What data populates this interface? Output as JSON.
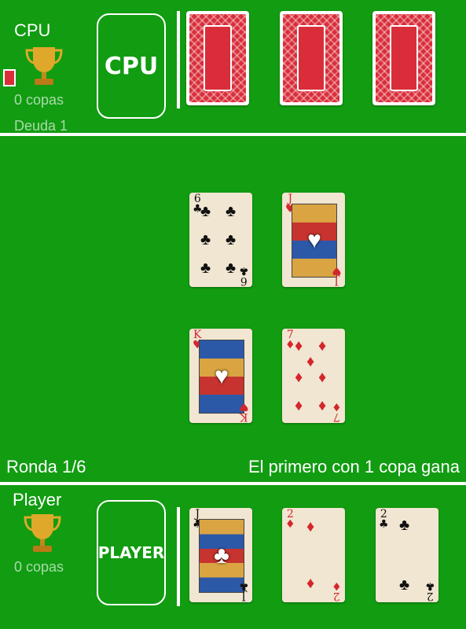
{
  "cpu": {
    "name": "CPU",
    "badge": "CPU",
    "copas": "0 copas",
    "deuda": "Deuda 1",
    "cards_face_down": 3
  },
  "table": {
    "cards": [
      {
        "rank": "6",
        "suit": "♣",
        "color": "black"
      },
      {
        "rank": "J",
        "suit": "♥",
        "color": "red"
      },
      {
        "rank": "K",
        "suit": "♥",
        "color": "red"
      },
      {
        "rank": "7",
        "suit": "♦",
        "color": "red"
      }
    ]
  },
  "status": {
    "round": "Ronda 1/6",
    "goal": "El primero con 1 copa gana"
  },
  "player": {
    "name": "Player",
    "badge": "PLAYER",
    "copas": "0 copas",
    "hand": [
      {
        "rank": "J",
        "suit": "♣",
        "color": "black"
      },
      {
        "rank": "2",
        "suit": "♦",
        "color": "red"
      },
      {
        "rank": "2",
        "suit": "♣",
        "color": "black"
      }
    ]
  },
  "colors": {
    "felt": "#119c11",
    "card_back": "#d92e3a",
    "trophy": "#e0a82a"
  }
}
